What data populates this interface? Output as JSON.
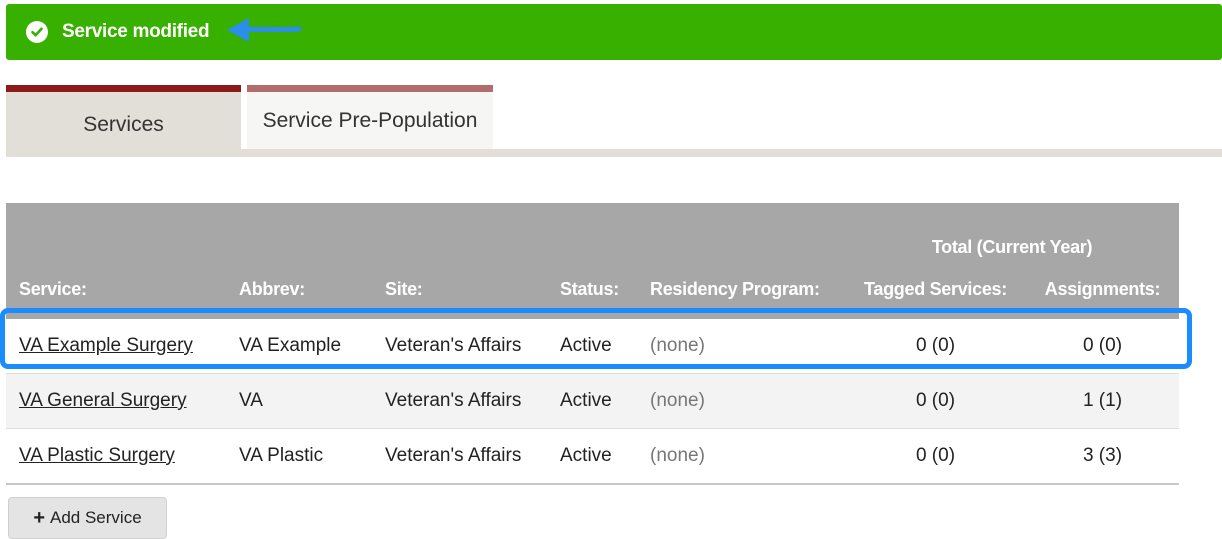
{
  "banner": {
    "message": "Service modified",
    "icon": "check-circle-icon",
    "background": "#37b000",
    "arrow_color": "#2b8eea"
  },
  "tabs": [
    {
      "label": "Services",
      "active": true
    },
    {
      "label": "Service Pre-Population",
      "active": false
    }
  ],
  "table": {
    "group_header": "Total (Current Year)",
    "columns": [
      "Service:",
      "Abbrev:",
      "Site:",
      "Status:",
      "Residency Program:",
      "Tagged Services:",
      "Assignments:"
    ],
    "rows": [
      {
        "service": "VA Example Surgery",
        "abbrev": "VA Example",
        "site": "Veteran's Affairs",
        "status": "Active",
        "residency": "(none)",
        "tagged": "0 (0)",
        "assignments": "0 (0)"
      },
      {
        "service": "VA General Surgery",
        "abbrev": "VA",
        "site": "Veteran's Affairs",
        "status": "Active",
        "residency": "(none)",
        "tagged": "0 (0)",
        "assignments": "1 (1)"
      },
      {
        "service": "VA Plastic Surgery",
        "abbrev": "VA Plastic",
        "site": "Veteran's Affairs",
        "status": "Active",
        "residency": "(none)",
        "tagged": "0 (0)",
        "assignments": "3 (3)"
      }
    ]
  },
  "highlight_color": "#1a8cff",
  "add_button": {
    "label": "Add Service",
    "icon": "plus-icon"
  }
}
